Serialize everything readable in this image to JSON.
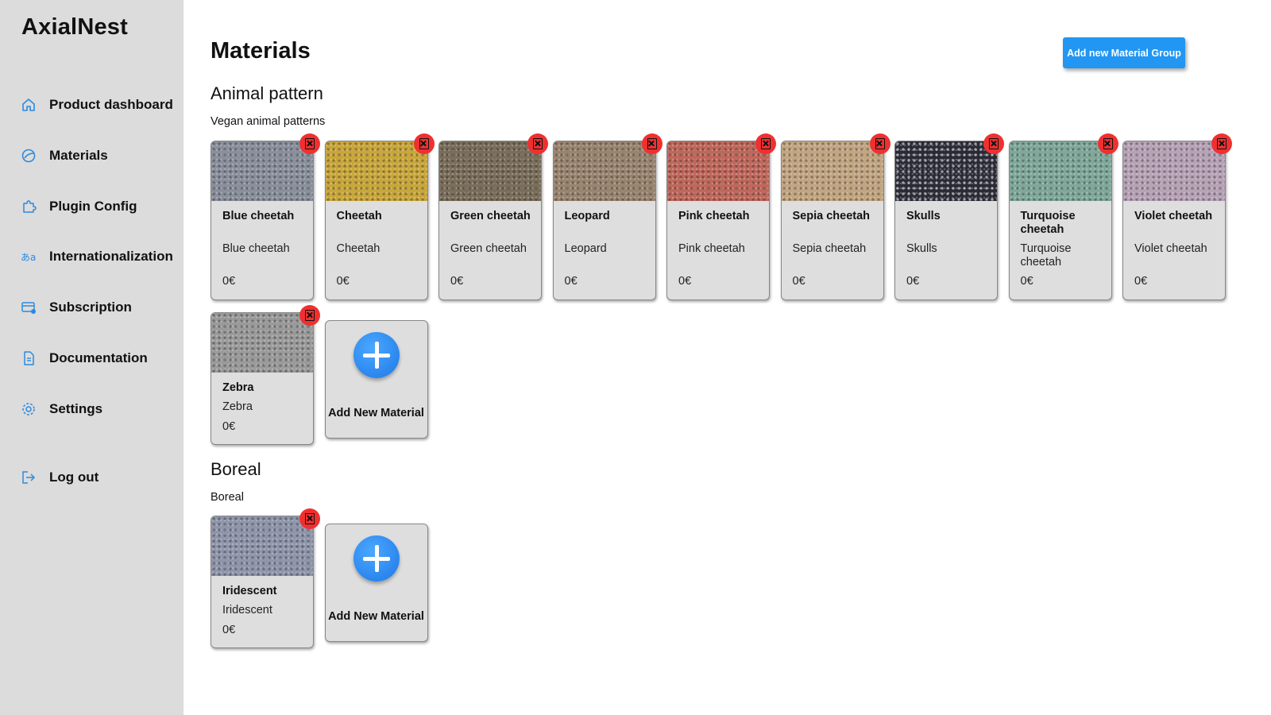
{
  "app": {
    "brand": "AxialNest"
  },
  "sidebar": {
    "items": [
      {
        "label": "Product dashboard",
        "icon": "home-icon"
      },
      {
        "label": "Materials",
        "icon": "palette-icon"
      },
      {
        "label": "Plugin Config",
        "icon": "puzzle-icon"
      },
      {
        "label": "Internationalization",
        "icon": "translate-icon"
      },
      {
        "label": "Subscription",
        "icon": "credit-card-icon"
      },
      {
        "label": "Documentation",
        "icon": "document-icon"
      },
      {
        "label": "Settings",
        "icon": "gear-icon"
      },
      {
        "label": "Log out",
        "icon": "logout-icon"
      }
    ]
  },
  "main": {
    "title": "Materials",
    "add_group_label": "Add new Material Group",
    "add_material_label": "Add New Material",
    "groups": [
      {
        "title": "Animal pattern",
        "description": "Vegan animal patterns",
        "materials": [
          {
            "name": "Blue cheetah",
            "description": "Blue cheetah",
            "price": "0€",
            "color": "#8a8f9c"
          },
          {
            "name": "Cheetah",
            "description": "Cheetah",
            "price": "0€",
            "color": "#c9a63a"
          },
          {
            "name": "Green cheetah",
            "description": "Green cheetah",
            "price": "0€",
            "color": "#7a6e5a"
          },
          {
            "name": "Leopard",
            "description": "Leopard",
            "price": "0€",
            "color": "#9a8470"
          },
          {
            "name": "Pink cheetah",
            "description": "Pink cheetah",
            "price": "0€",
            "color": "#c0675c"
          },
          {
            "name": "Sepia cheetah",
            "description": "Sepia cheetah",
            "price": "0€",
            "color": "#c2a581"
          },
          {
            "name": "Skulls",
            "description": "Skulls",
            "price": "0€",
            "color": "#2a2a36"
          },
          {
            "name": "Turquoise cheetah",
            "description": "Turquoise cheetah",
            "price": "0€",
            "color": "#7fa89a"
          },
          {
            "name": "Violet cheetah",
            "description": "Violet cheetah",
            "price": "0€",
            "color": "#b7a2b6"
          },
          {
            "name": "Zebra",
            "description": "Zebra",
            "price": "0€",
            "color": "#9a9a9a"
          }
        ]
      },
      {
        "title": "Boreal",
        "description": "Boreal",
        "materials": [
          {
            "name": "Iridescent",
            "description": "Iridescent",
            "price": "0€",
            "color": "#8f95aa"
          }
        ]
      }
    ]
  },
  "colors": {
    "accent": "#2196f3",
    "delete": "#f03030",
    "sidebar_bg": "#dcdcdc",
    "card_bg": "#dedede"
  }
}
